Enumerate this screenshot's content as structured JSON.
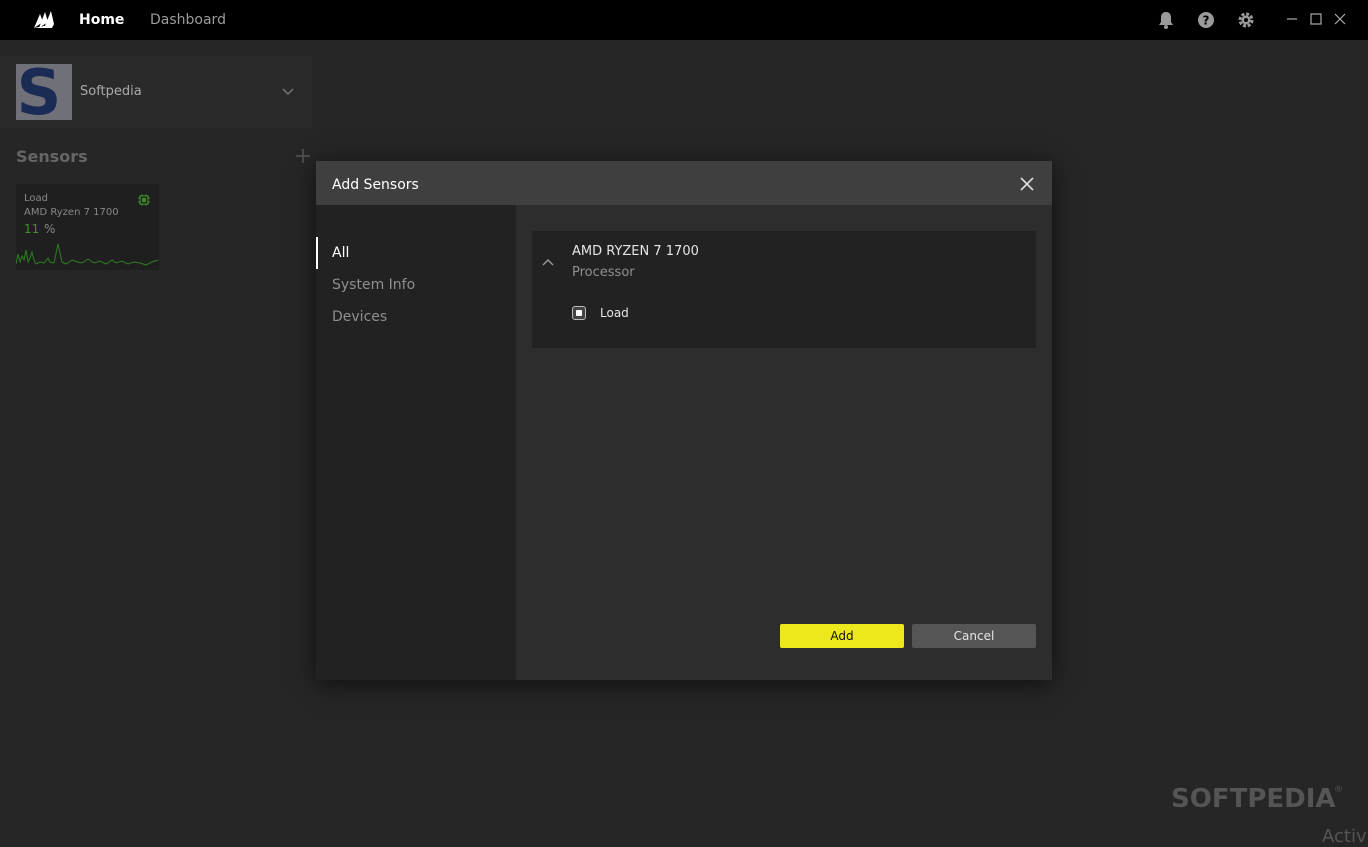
{
  "titlebar": {
    "tabs": [
      {
        "label": "Home",
        "active": true
      },
      {
        "label": "Dashboard",
        "active": false
      }
    ],
    "icons": [
      "bell-icon",
      "help-icon",
      "gear-icon"
    ],
    "window_controls": [
      "minimize-icon",
      "maximize-icon",
      "close-icon"
    ]
  },
  "profile": {
    "name": "Softpedia",
    "avatar_letter": "S"
  },
  "sensors": {
    "title": "Sensors",
    "tile": {
      "label": "Load",
      "device": "AMD Ryzen 7 1700",
      "value": "11",
      "unit": "%",
      "accent": "#3c8f2a"
    }
  },
  "dialog": {
    "title": "Add Sensors",
    "sidebar": [
      {
        "label": "All",
        "active": true
      },
      {
        "label": "System Info",
        "active": false
      },
      {
        "label": "Devices",
        "active": false
      }
    ],
    "device": {
      "name": "AMD RYZEN 7 1700",
      "type": "Processor",
      "sensor_label": "Load",
      "sensor_checked": true
    },
    "add_label": "Add",
    "cancel_label": "Cancel",
    "accent": "#ede81c"
  },
  "watermark": {
    "text": "SOFTPEDIA",
    "reg": "®",
    "activate": "Activ"
  }
}
